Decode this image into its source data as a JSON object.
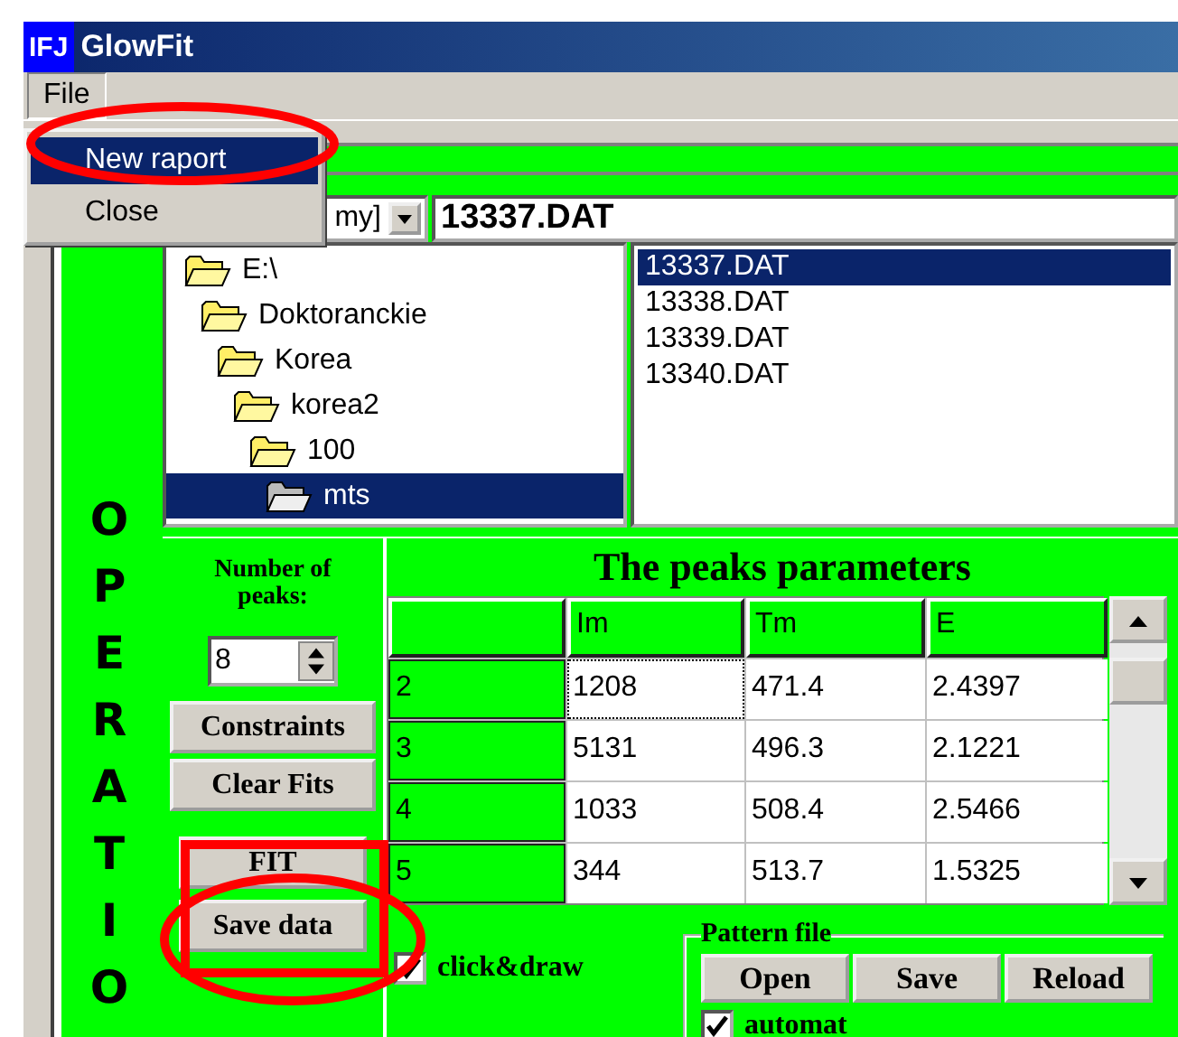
{
  "window": {
    "icon": "IFJ",
    "title": "GlowFit"
  },
  "menu_bar": [
    {
      "label": "File",
      "selected": true
    }
  ],
  "menu": {
    "items": [
      {
        "label": "New raport",
        "selected": true
      },
      {
        "label": "Close",
        "selected": false
      }
    ]
  },
  "drive": {
    "value": "my]"
  },
  "file_name": {
    "value": "13337.DAT"
  },
  "folders": [
    {
      "label": "E:\\",
      "selected": false,
      "children": [
        {
          "label": "Doktoranckie",
          "selected": false,
          "children": [
            {
              "label": "Korea",
              "selected": false,
              "children": [
                {
                  "label": "korea2",
                  "selected": false,
                  "children": [
                    {
                      "label": "100",
                      "selected": false,
                      "children": [
                        {
                          "label": "mts",
                          "selected": true
                        }
                      ]
                    }
                  ]
                }
              ]
            }
          ]
        }
      ]
    }
  ],
  "files": [
    {
      "label": "13337.DAT",
      "selected": true
    },
    {
      "label": "13338.DAT",
      "selected": false
    },
    {
      "label": "13339.DAT",
      "selected": false
    },
    {
      "label": "13340.DAT",
      "selected": false
    }
  ],
  "side_title": "OPERATIO",
  "peaks": {
    "label": "Number of peaks:",
    "value": "8"
  },
  "buttons": [
    "Constraints",
    "Clear Fits",
    "FIT",
    "Save data"
  ],
  "table": {
    "title": "The peaks parameters",
    "columns": [
      "Im",
      "Tm",
      "E"
    ],
    "rows": [
      {
        "label": "2",
        "values": [
          "1208",
          "471.4",
          "2.4397"
        ],
        "focused": true
      },
      {
        "label": "3",
        "values": [
          "5131",
          "496.3",
          "2.1221"
        ],
        "focused": false
      },
      {
        "label": "4",
        "values": [
          "1033",
          "508.4",
          "2.5466"
        ],
        "focused": false
      },
      {
        "label": "5",
        "values": [
          "344",
          "513.7",
          "1.5325"
        ],
        "focused": false
      }
    ]
  },
  "click_draw": {
    "label": "click&draw",
    "checked": true
  },
  "pattern_file": {
    "title": "Pattern file",
    "buttons": [
      "Open",
      "Save",
      "Reload"
    ],
    "automat": {
      "label": "automat",
      "checked": true
    }
  },
  "annotations": [
    {
      "kind": "ellipse"
    },
    {
      "kind": "rectangle"
    },
    {
      "kind": "ellipse"
    }
  ]
}
